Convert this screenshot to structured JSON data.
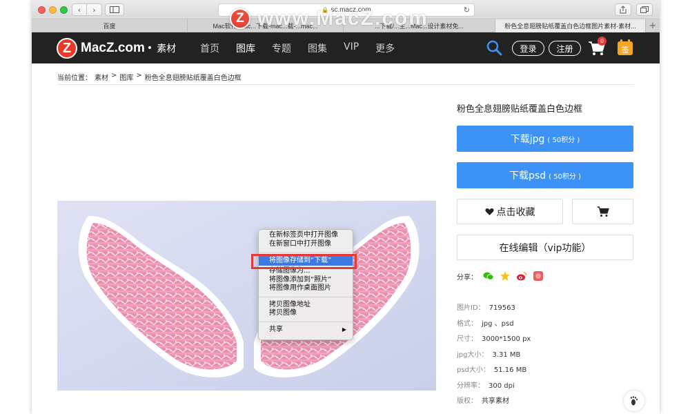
{
  "browser": {
    "url": "sc.macz.com",
    "tabs": [
      {
        "title": "百度",
        "active": false
      },
      {
        "title": "Mac软件-mac...下载-mac...载-...mac...",
        "active": false
      },
      {
        "title": "...下载/...主...Mac...设计素材免...",
        "active": false
      },
      {
        "title": "粉色全息翅膀贴纸覆盖白色边框图片素材-素材...",
        "active": true
      }
    ]
  },
  "watermark": {
    "logo_letter": "Z",
    "text": "www.MacZ.com"
  },
  "site": {
    "logo_letter": "Z",
    "logo_text": "MacZ.com",
    "logo_dot": "•",
    "logo_sub": "素材",
    "nav": [
      "首页",
      "图库",
      "专题",
      "图集",
      "VIP",
      "更多"
    ],
    "active_nav": "图库",
    "login": "登录",
    "register": "注册",
    "cart_count": "0",
    "calendar_label": "签"
  },
  "breadcrumb": {
    "prefix": "当前位置：",
    "items": [
      "素材",
      ">",
      "图库",
      ">",
      "粉色全息翅膀贴纸覆盖白色边框"
    ]
  },
  "context_menu": {
    "items": [
      "在新标签页中打开图像",
      "在新窗口中打开图像"
    ],
    "highlighted": "将图像存储到“下载”",
    "items2": [
      "存储图像为...",
      "将图像添加到“照片”",
      "将图像用作桌面图片"
    ],
    "items3": [
      "拷贝图像地址",
      "拷贝图像"
    ],
    "share": "共享",
    "share_arrow": "▶"
  },
  "detail": {
    "title": "粉色全息翅膀贴纸覆盖白色边框",
    "download_jpg": "下载jpg",
    "download_psd": "下载psd",
    "points": "( 50积分 )",
    "favorite": "点击收藏",
    "online_edit": "在线编辑（vip功能）",
    "share_label": "分享：",
    "meta": [
      {
        "k": "图片ID：",
        "v": "719563"
      },
      {
        "k": "格式：",
        "v": "jpg 、psd"
      },
      {
        "k": "尺寸：",
        "v": "3000*1500 px"
      },
      {
        "k": "jpg大小：",
        "v": "3.31 MB"
      },
      {
        "k": "psd大小：",
        "v": "51.16 MB"
      },
      {
        "k": "分辨率：",
        "v": "300 dpi"
      },
      {
        "k": "版权：",
        "v": "共享素材"
      }
    ]
  },
  "colors": {
    "accent": "#3d93f5",
    "header": "#222222",
    "highlight": "#3d79e3",
    "red_box": "#e33a3a",
    "logo_red": "#e8392a"
  }
}
